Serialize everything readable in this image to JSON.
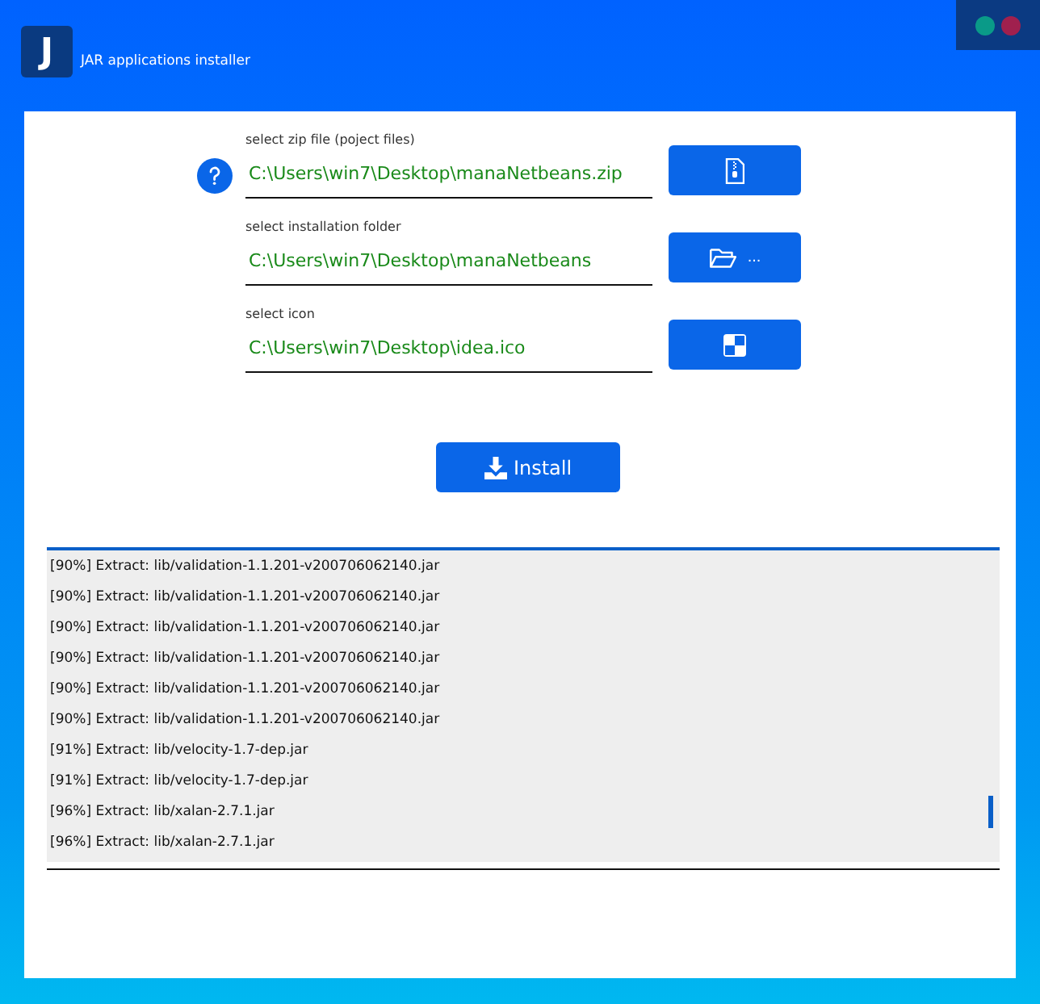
{
  "window": {
    "logo": "J",
    "title": "JAR applications installer"
  },
  "fields": [
    {
      "label": "select zip file (poject files)",
      "value": "C:\\Users\\win7\\Desktop\\manaNetbeans.zip",
      "button": {
        "kind": "zip"
      },
      "help": true
    },
    {
      "label": "select installation folder",
      "value": "C:\\Users\\win7\\Desktop\\manaNetbeans",
      "button": {
        "kind": "folder",
        "text": "..."
      },
      "help": false
    },
    {
      "label": "select icon",
      "value": "C:\\Users\\win7\\Desktop\\idea.ico",
      "button": {
        "kind": "icon"
      },
      "help": false
    }
  ],
  "install_button": "Install",
  "log": [
    "[90%] Extract: lib/validation-1.1.201-v200706062140.jar",
    "[90%] Extract: lib/validation-1.1.201-v200706062140.jar",
    "[90%] Extract: lib/validation-1.1.201-v200706062140.jar",
    "[90%] Extract: lib/validation-1.1.201-v200706062140.jar",
    "[90%] Extract: lib/validation-1.1.201-v200706062140.jar",
    "[90%] Extract: lib/validation-1.1.201-v200706062140.jar",
    "[91%] Extract: lib/velocity-1.7-dep.jar",
    "[91%] Extract: lib/velocity-1.7-dep.jar",
    "[96%] Extract: lib/xalan-2.7.1.jar",
    "[96%] Extract: lib/xalan-2.7.1.jar"
  ]
}
